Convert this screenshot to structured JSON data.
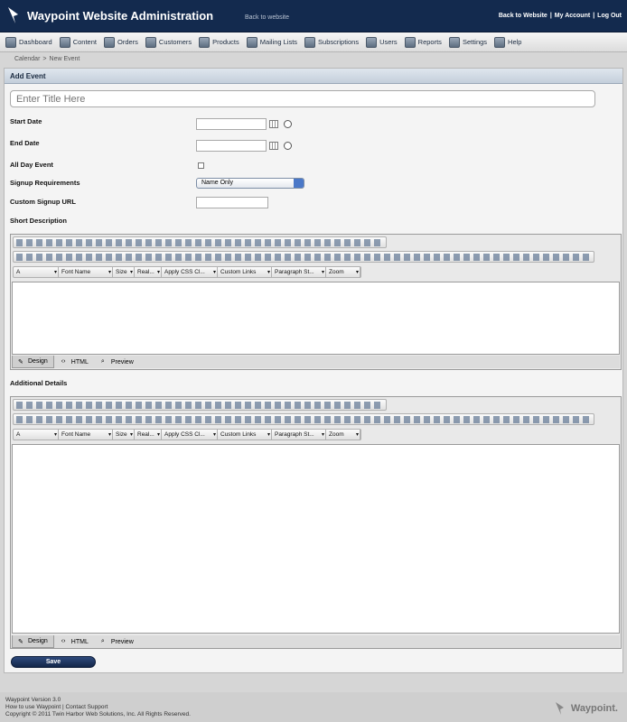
{
  "header": {
    "title": "Waypoint Website Administration",
    "back_link": "Back to website",
    "links": [
      "Back to Website",
      "|",
      "My Account",
      "|",
      "Log Out"
    ]
  },
  "nav": [
    {
      "label": "Dashboard",
      "icon": "dashboard-icon"
    },
    {
      "label": "Content",
      "icon": "content-icon"
    },
    {
      "label": "Orders",
      "icon": "orders-icon"
    },
    {
      "label": "Customers",
      "icon": "customers-icon"
    },
    {
      "label": "Products",
      "icon": "products-icon"
    },
    {
      "label": "Mailing Lists",
      "icon": "mailing-lists-icon"
    },
    {
      "label": "Subscriptions",
      "icon": "subscriptions-icon"
    },
    {
      "label": "Users",
      "icon": "users-icon"
    },
    {
      "label": "Reports",
      "icon": "reports-icon"
    },
    {
      "label": "Settings",
      "icon": "settings-icon"
    },
    {
      "label": "Help",
      "icon": "help-icon"
    }
  ],
  "breadcrumb": {
    "parent": "Calendar",
    "sep": ">",
    "current": "New Event"
  },
  "form": {
    "panel_title": "Add Event",
    "title_placeholder": "Enter Title Here",
    "start_date_label": "Start Date",
    "end_date_label": "End Date",
    "all_day_label": "All Day Event",
    "signup_req_label": "Signup Requirements",
    "signup_req_value": "Name Only",
    "custom_url_label": "Custom Signup URL",
    "short_desc_label": "Short Description",
    "additional_label": "Additional Details",
    "save_label": "Save"
  },
  "editor": {
    "dropdowns": [
      "Font Name",
      "Size",
      "Real...",
      "Apply CSS Cl...",
      "Custom Links",
      "Paragraph St...",
      "Zoom"
    ],
    "tabs": [
      {
        "label": "Design",
        "icon": "pencil-icon"
      },
      {
        "label": "HTML",
        "icon": "code-icon"
      },
      {
        "label": "Preview",
        "icon": "magnifier-icon"
      }
    ]
  },
  "footer": {
    "version": "Waypoint Version 3.0",
    "help_links": "How to use Waypoint | Contact Support",
    "copyright": "Copyright © 2011 Twin Harbor Web Solutions, Inc. All Rights Reserved.",
    "logo_text": "Waypoint."
  },
  "colors": {
    "header_bg": "#132a4e",
    "accent": "#4a78c8"
  }
}
